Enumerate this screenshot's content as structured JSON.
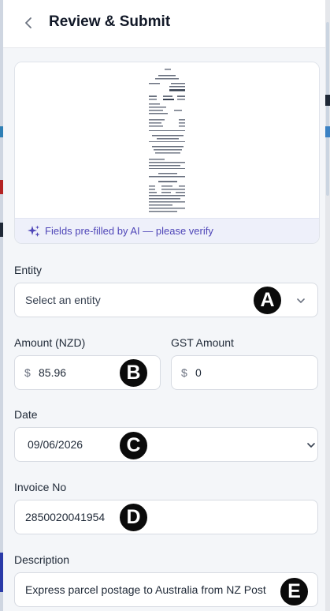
{
  "header": {
    "back_icon": "chevron-left-icon",
    "title": "Review & Submit"
  },
  "receipt": {
    "ai_icon": "sparkles-icon",
    "ai_notice": "Fields pre-filled by AI — please verify"
  },
  "entity": {
    "label": "Entity",
    "placeholder": "Select an entity",
    "icon": "chevron-down-icon"
  },
  "amount": {
    "label": "Amount (NZD)",
    "currency": "$",
    "value": "85.96"
  },
  "gst": {
    "label": "GST Amount",
    "currency": "$",
    "value": "0"
  },
  "date": {
    "label": "Date",
    "value": "09/06/2026",
    "icon": "chevron-down-icon"
  },
  "invoice": {
    "label": "Invoice No",
    "value": "2850020041954"
  },
  "description": {
    "label": "Description",
    "value": "Express parcel postage to Australia from NZ Post"
  },
  "annotations": {
    "a": "A",
    "b": "B",
    "c": "C",
    "d": "D",
    "e": "E"
  },
  "colors": {
    "accent": "#4f46b8",
    "panel_bg": "#f4f6f9",
    "badge_bg": "#0b0b0b"
  }
}
